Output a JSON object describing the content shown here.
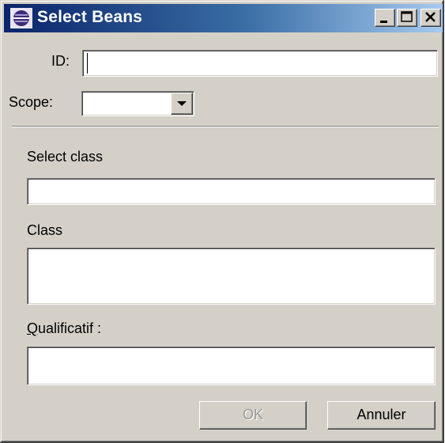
{
  "window": {
    "title": "Select Beans",
    "controls": [
      "minimize-icon",
      "maximize-icon",
      "close-icon"
    ]
  },
  "form": {
    "id_label": "ID:",
    "id_value": "",
    "scope_label": "Scope:",
    "scope_value": "",
    "select_class_label": "Select class",
    "select_class_value": "",
    "class_label": "Class",
    "class_value": "",
    "qualifier_label": "Qualificatif :",
    "qualifier_value": ""
  },
  "buttons": {
    "ok_label": "OK",
    "ok_enabled": false,
    "cancel_label": "Annuler"
  },
  "colors": {
    "titlebar_start": "#0a246a",
    "titlebar_end": "#a6caf0",
    "face": "#d4d0c8"
  }
}
